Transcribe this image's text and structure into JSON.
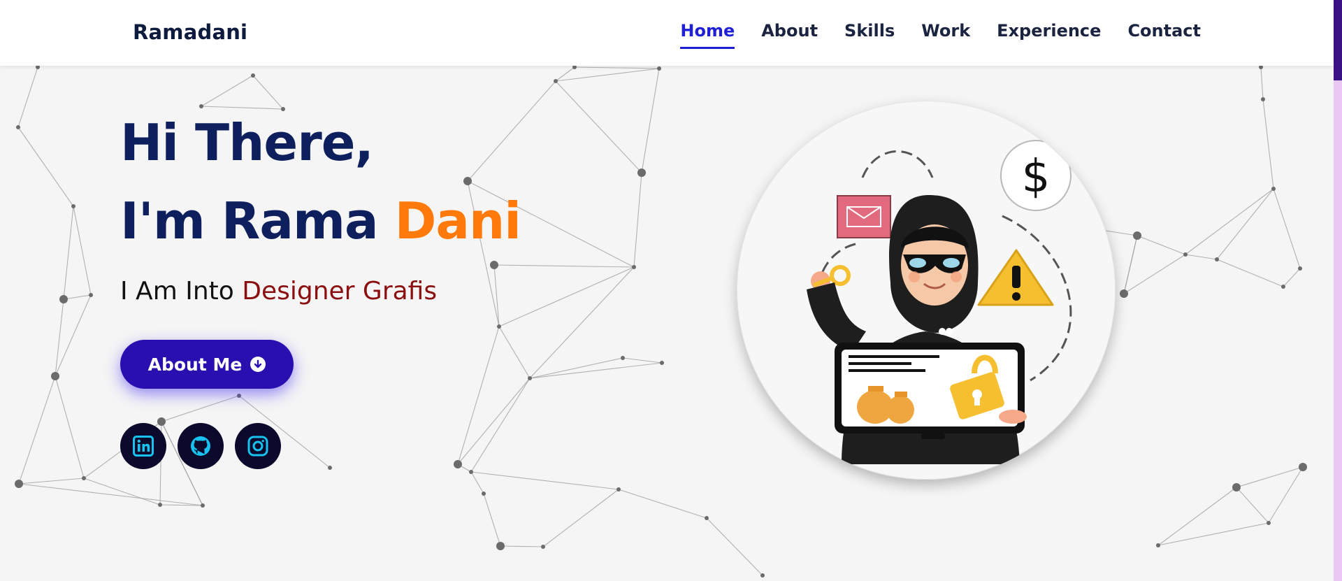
{
  "header": {
    "brand": "Ramadani",
    "nav": [
      {
        "label": "Home",
        "active": true
      },
      {
        "label": "About",
        "active": false
      },
      {
        "label": "Skills",
        "active": false
      },
      {
        "label": "Work",
        "active": false
      },
      {
        "label": "Experience",
        "active": false
      },
      {
        "label": "Contact",
        "active": false
      }
    ]
  },
  "hero": {
    "greeting": "Hi There,",
    "intro": "I'm Rama",
    "name": "Dani",
    "subtitle_prefix": "I Am Into",
    "subtitle_role": "Designer Grafis",
    "cta_label": "About Me",
    "cta_icon": "arrow-down-circle-icon",
    "socials": [
      {
        "name": "linkedin-icon"
      },
      {
        "name": "github-icon"
      },
      {
        "name": "instagram-icon"
      }
    ]
  },
  "colors": {
    "heading": "#0d1f5c",
    "accent_orange": "#ff7a0a",
    "role_red": "#8c0f10",
    "button": "#2a0fb0",
    "nav_active": "#1f1fd6",
    "social_bg": "#0c0a2c",
    "social_icon": "#17c3ee"
  }
}
